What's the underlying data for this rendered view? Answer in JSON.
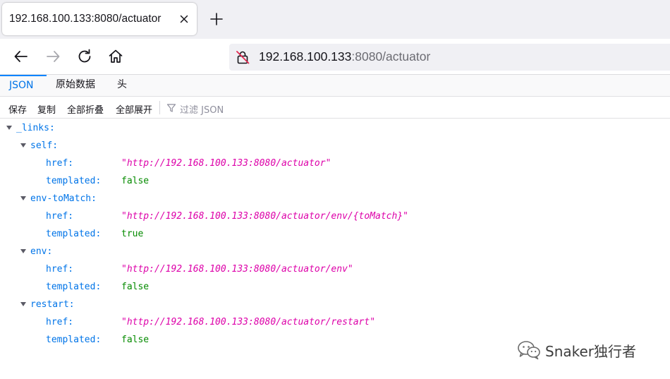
{
  "browser": {
    "tab_title": "192.168.100.133:8080/actuator",
    "url_host": "192.168.100.133",
    "url_rest": ":8080/actuator",
    "icons": {
      "close": "close-icon",
      "new_tab": "plus-icon",
      "back": "back-arrow-icon",
      "forward": "forward-arrow-icon",
      "reload": "reload-icon",
      "home": "home-icon",
      "insecure": "insecure-lock-icon"
    }
  },
  "viewer": {
    "tabs": [
      "JSON",
      "原始数据",
      "头"
    ],
    "active_tab": "JSON",
    "toolbar": {
      "save": "保存",
      "copy": "复制",
      "collapse_all": "全部折叠",
      "expand_all": "全部展开",
      "filter_placeholder": "过滤 JSON"
    }
  },
  "json_tree": {
    "root_key": "_links:",
    "entries": [
      {
        "key": "self:",
        "href_label": "href:",
        "href": "\"http://192.168.100.133:8080/actuator\"",
        "templated_label": "templated:",
        "templated": "false"
      },
      {
        "key": "env-toMatch:",
        "href_label": "href:",
        "href": "\"http://192.168.100.133:8080/actuator/env/{toMatch}\"",
        "templated_label": "templated:",
        "templated": "true"
      },
      {
        "key": "env:",
        "href_label": "href:",
        "href": "\"http://192.168.100.133:8080/actuator/env\"",
        "templated_label": "templated:",
        "templated": "false"
      },
      {
        "key": "restart:",
        "href_label": "href:",
        "href": "\"http://192.168.100.133:8080/actuator/restart\"",
        "templated_label": "templated:",
        "templated": "false"
      }
    ]
  },
  "watermark": {
    "text": "Snaker独行者",
    "icon": "wechat-icon"
  },
  "colors": {
    "key": "#0074e8",
    "string": "#dd00a9",
    "boolean": "#058b00",
    "active_tab": "#0a84ff"
  }
}
